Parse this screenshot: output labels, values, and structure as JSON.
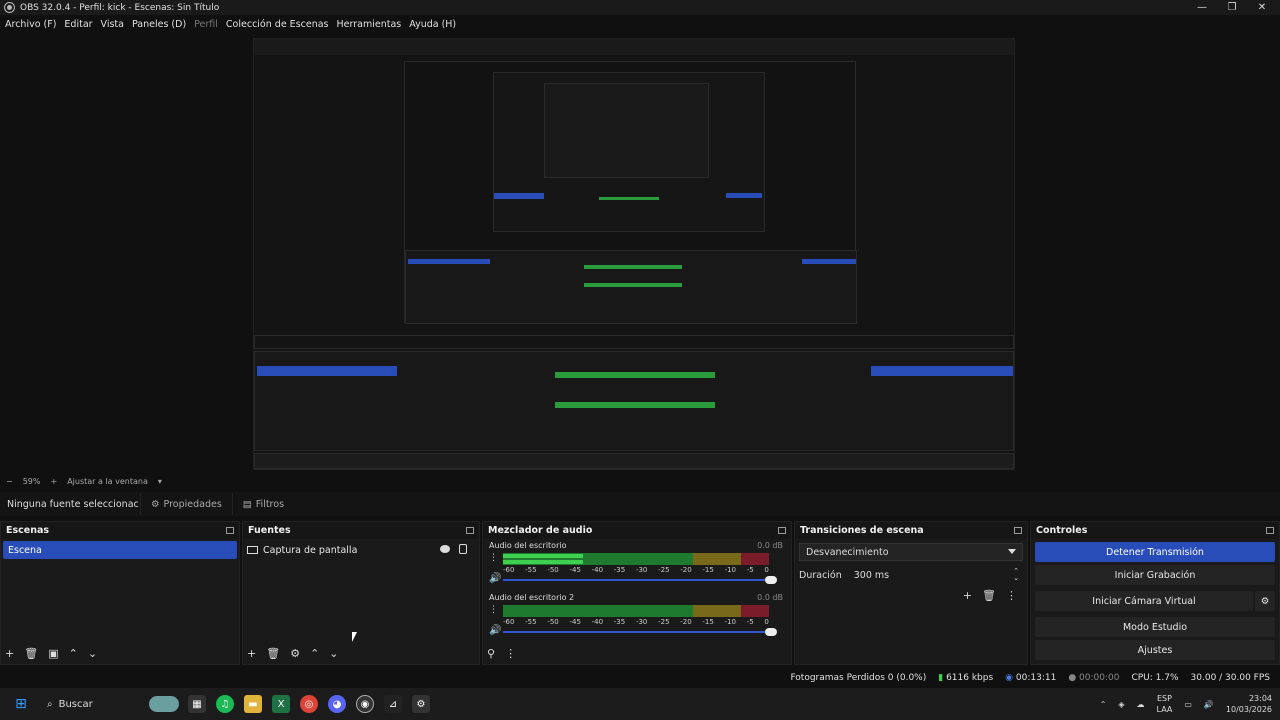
{
  "window": {
    "title": "OBS 32.0.4 - Perfil: kick - Escenas: Sin Título",
    "minimize": "—",
    "maximize": "❐",
    "close": "✕"
  },
  "menu": [
    {
      "label": "Archivo (F)",
      "enabled": true
    },
    {
      "label": "Editar",
      "enabled": true
    },
    {
      "label": "Vista",
      "enabled": true
    },
    {
      "label": "Paneles (D)",
      "enabled": true
    },
    {
      "label": "Perfil",
      "enabled": false
    },
    {
      "label": "Colección de Escenas",
      "enabled": true
    },
    {
      "label": "Herramientas",
      "enabled": true
    },
    {
      "label": "Ayuda (H)",
      "enabled": true
    }
  ],
  "zoom": {
    "minus": "−",
    "value": "59%",
    "plus": "+",
    "fit": "Ajustar a la ventana"
  },
  "props_bar": {
    "no_source": "Ninguna fuente seleccionac",
    "properties": "Propiedades",
    "filters": "Filtros"
  },
  "scenes": {
    "title": "Escenas",
    "items": [
      "Escena"
    ]
  },
  "sources": {
    "title": "Fuentes",
    "items": [
      "Captura de pantalla"
    ]
  },
  "mixer": {
    "title": "Mezclador de audio",
    "tracks": [
      {
        "name": "Audio del escritorio",
        "db": "0.0 dB",
        "level": 0.3
      },
      {
        "name": "Audio del escritorio 2",
        "db": "0.0 dB",
        "level": 0.0
      }
    ],
    "scale": [
      "-60",
      "-55",
      "-50",
      "-45",
      "-40",
      "-35",
      "-30",
      "-25",
      "-20",
      "-15",
      "-10",
      "-5",
      "0"
    ]
  },
  "transitions": {
    "title": "Transiciones de escena",
    "selected": "Desvanecimiento",
    "duration_label": "Duración",
    "duration_value": "300 ms"
  },
  "controls": {
    "title": "Controles",
    "buttons": [
      "Detener Transmisión",
      "Iniciar Grabación",
      "Iniciar Cámara Virtual",
      "Modo Estudio",
      "Ajustes"
    ]
  },
  "status": {
    "dropped": "Fotogramas Perdidos 0 (0.0%)",
    "bitrate": "6116 kbps",
    "stream_time": "00:13:11",
    "rec_time": "00:00:00",
    "cpu": "CPU: 1.7%",
    "fps": "30.00 / 30.00 FPS"
  },
  "taskbar": {
    "search": "Buscar",
    "lang1": "ESP",
    "lang2": "LAA",
    "time": "23:04",
    "date": "10/03/2026"
  },
  "colors": {
    "accent": "#284cb8",
    "meter_green": "#1e7a2f",
    "meter_yellow": "#786a1a",
    "meter_red": "#7a1c2a",
    "level": "#3dd14f"
  }
}
